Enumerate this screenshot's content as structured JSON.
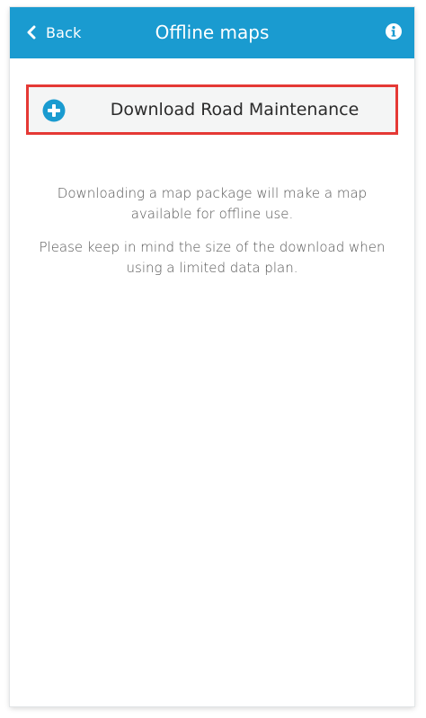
{
  "header": {
    "back_label": "Back",
    "title": "Offline maps",
    "back_icon": "chevron-left-icon",
    "info_icon": "info-icon"
  },
  "download": {
    "label": "Download Road Maintenance",
    "icon": "plus-circle-icon"
  },
  "info": {
    "paragraph_1": "Downloading a map package will make a map available for offline use.",
    "paragraph_2": "Please keep in mind the size of the download when using a limited data plan."
  },
  "colors": {
    "header_bg": "#1a9bd0",
    "accent": "#1a9bd0",
    "highlight_border": "#e53935",
    "button_bg": "#f4f5f5"
  }
}
